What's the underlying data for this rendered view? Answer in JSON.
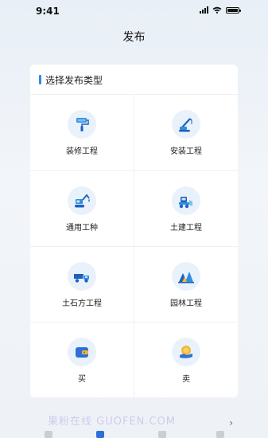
{
  "status_bar": {
    "time": "9:41"
  },
  "page": {
    "title": "发布"
  },
  "card": {
    "title": "选择发布类型",
    "items": [
      {
        "label": "装修工程",
        "icon": "paint-roller-icon"
      },
      {
        "label": "安装工程",
        "icon": "crane-icon"
      },
      {
        "label": "通用工种",
        "icon": "excavator-icon"
      },
      {
        "label": "土建工程",
        "icon": "bulldozer-icon"
      },
      {
        "label": "土石方工程",
        "icon": "dump-truck-icon"
      },
      {
        "label": "园林工程",
        "icon": "trees-icon"
      },
      {
        "label": "买",
        "icon": "wallet-icon"
      },
      {
        "label": "卖",
        "icon": "coin-hand-icon"
      }
    ]
  },
  "watermark": {
    "text": "果粉在线 GUOFEN.COM"
  },
  "colors": {
    "accent": "#2f8fe0",
    "icon_bg": "#e9f2fb",
    "icon_dark": "#1f5fbf"
  }
}
